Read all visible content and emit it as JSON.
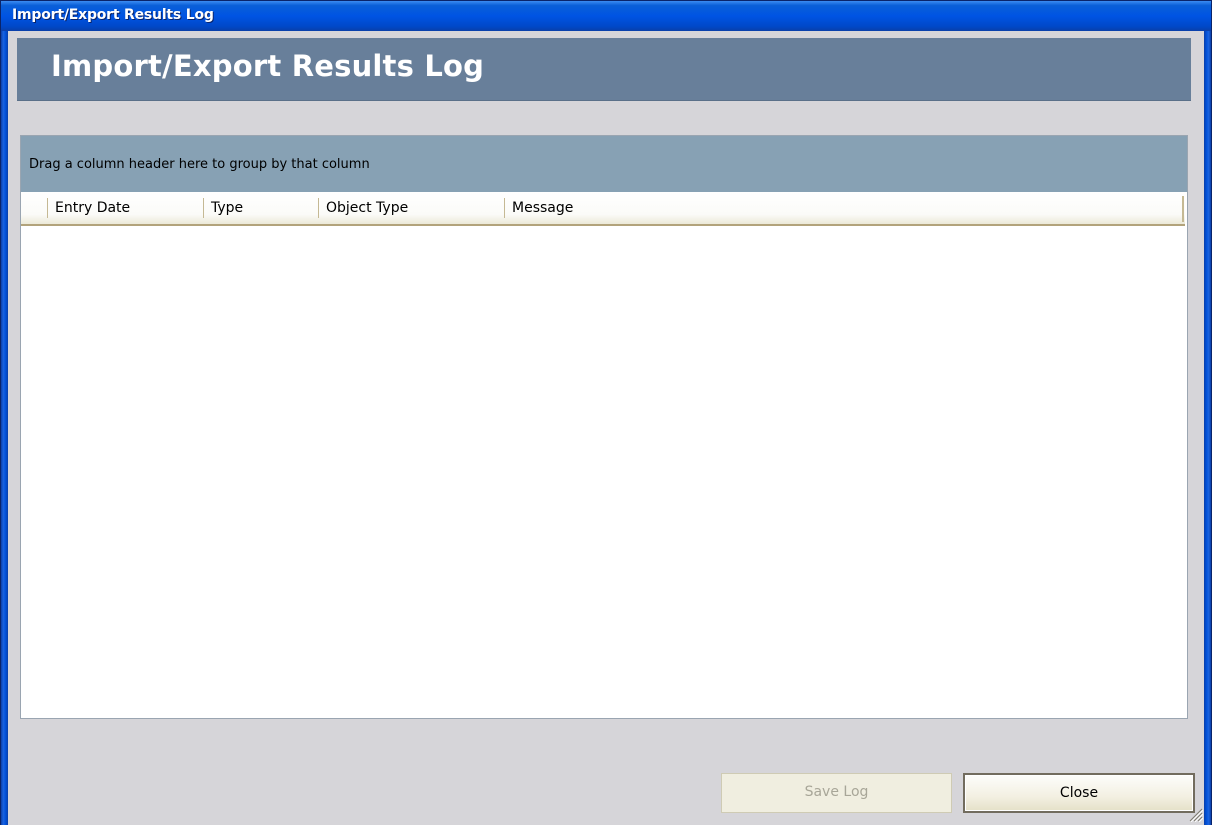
{
  "window": {
    "title": "Import/Export Results Log"
  },
  "banner": {
    "title": "Import/Export Results Log"
  },
  "grid": {
    "group_by_hint": "Drag a column header here to group by that column",
    "columns": [
      "Entry Date",
      "Type",
      "Object Type",
      "Message"
    ],
    "rows": []
  },
  "buttons": {
    "save_log": "Save Log",
    "close": "Close"
  },
  "colors": {
    "titlebar": "#0054e3",
    "banner": "#687f9a",
    "group_panel": "#87a1b4",
    "client_background": "#d6d5d9"
  }
}
